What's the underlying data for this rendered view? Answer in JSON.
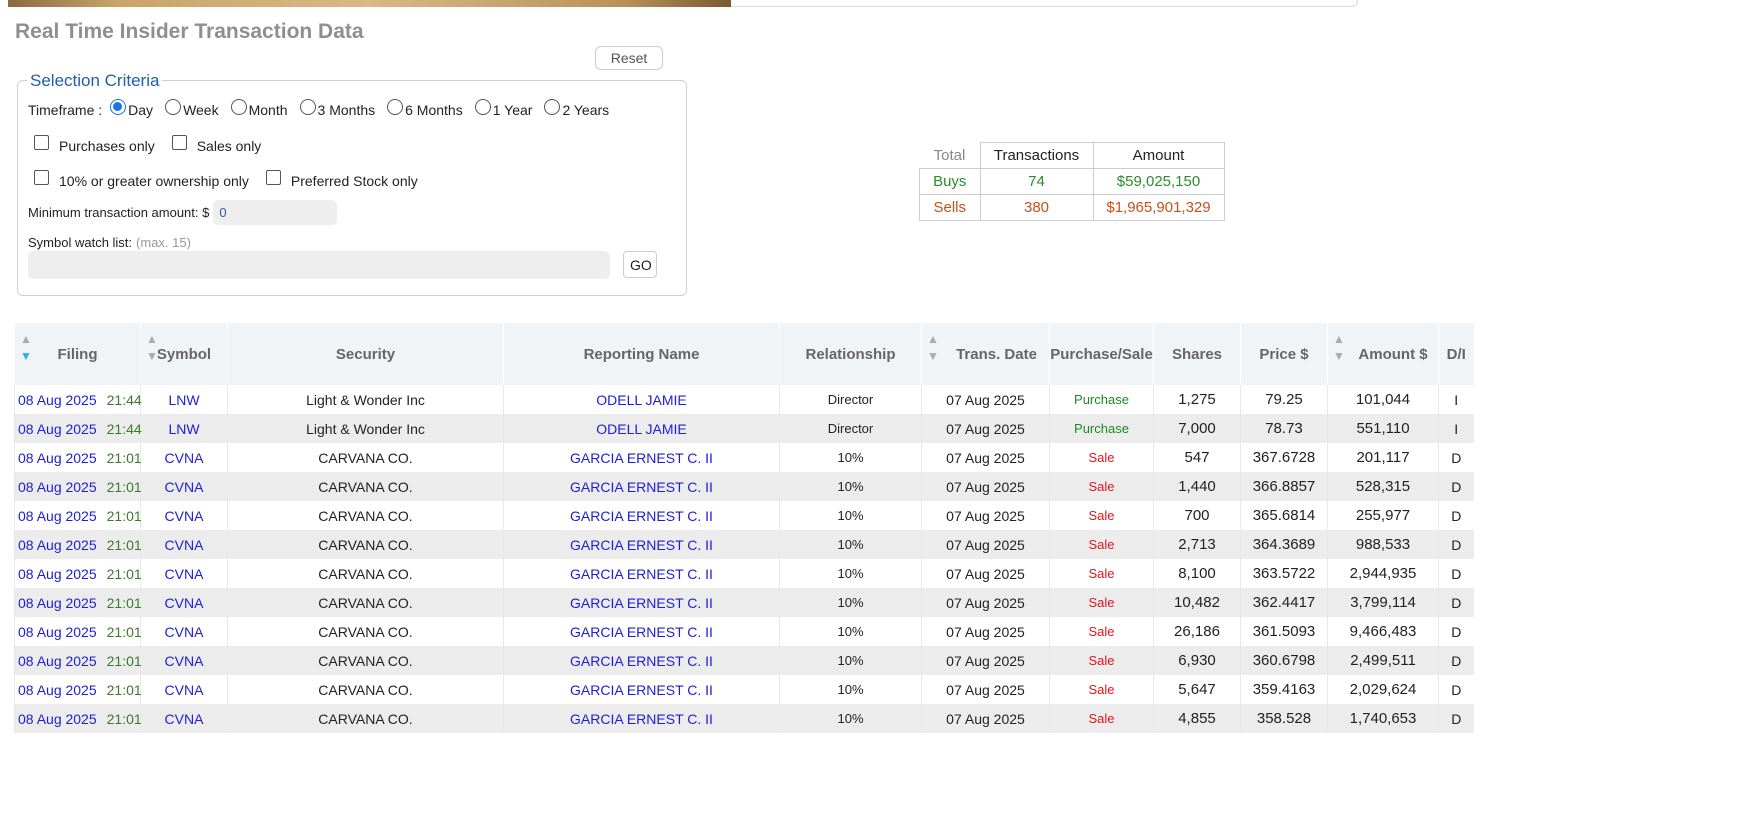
{
  "page_title": "Real Time Insider Transaction Data",
  "reset_label": "Reset",
  "criteria": {
    "legend": "Selection Criteria",
    "timeframe_label": "Timeframe :",
    "timeframes": [
      "Day",
      "Week",
      "Month",
      "3 Months",
      "6 Months",
      "1 Year",
      "2 Years"
    ],
    "selected_timeframe": "Day",
    "purchases_only": "Purchases only",
    "sales_only": "Sales only",
    "ownership_only": "10% or greater ownership only",
    "preferred_only": "Preferred Stock only",
    "min_amount_label": "Minimum transaction amount: $",
    "min_amount_value": "0",
    "watchlist_label": "Symbol watch list:",
    "watchlist_hint": "(max. 15)",
    "go_label": "GO"
  },
  "summary": {
    "corner": "Total",
    "headers": [
      "Transactions",
      "Amount"
    ],
    "buys": {
      "label": "Buys",
      "transactions": "74",
      "amount": "$59,025,150"
    },
    "sells": {
      "label": "Sells",
      "transactions": "380",
      "amount": "$1,965,901,329"
    }
  },
  "table": {
    "headers": [
      "Filing",
      "Symbol",
      "Security",
      "Reporting Name",
      "Relationship",
      "Trans. Date",
      "Purchase/Sale",
      "Shares",
      "Price $",
      "Amount $",
      "D/I"
    ],
    "rows": [
      {
        "date": "08 Aug 2025",
        "time": "21:44",
        "symbol": "LNW",
        "security": "Light & Wonder Inc",
        "name": "ODELL JAMIE",
        "relationship": "Director",
        "trans_date": "07 Aug 2025",
        "type": "Purchase",
        "shares": "1,275",
        "price": "79.25",
        "amount": "101,044",
        "di": "I"
      },
      {
        "date": "08 Aug 2025",
        "time": "21:44",
        "symbol": "LNW",
        "security": "Light & Wonder Inc",
        "name": "ODELL JAMIE",
        "relationship": "Director",
        "trans_date": "07 Aug 2025",
        "type": "Purchase",
        "shares": "7,000",
        "price": "78.73",
        "amount": "551,110",
        "di": "I"
      },
      {
        "date": "08 Aug 2025",
        "time": "21:01",
        "symbol": "CVNA",
        "security": "CARVANA CO.",
        "name": "GARCIA ERNEST C. II",
        "relationship": "10%",
        "trans_date": "07 Aug 2025",
        "type": "Sale",
        "shares": "547",
        "price": "367.6728",
        "amount": "201,117",
        "di": "D"
      },
      {
        "date": "08 Aug 2025",
        "time": "21:01",
        "symbol": "CVNA",
        "security": "CARVANA CO.",
        "name": "GARCIA ERNEST C. II",
        "relationship": "10%",
        "trans_date": "07 Aug 2025",
        "type": "Sale",
        "shares": "1,440",
        "price": "366.8857",
        "amount": "528,315",
        "di": "D"
      },
      {
        "date": "08 Aug 2025",
        "time": "21:01",
        "symbol": "CVNA",
        "security": "CARVANA CO.",
        "name": "GARCIA ERNEST C. II",
        "relationship": "10%",
        "trans_date": "07 Aug 2025",
        "type": "Sale",
        "shares": "700",
        "price": "365.6814",
        "amount": "255,977",
        "di": "D"
      },
      {
        "date": "08 Aug 2025",
        "time": "21:01",
        "symbol": "CVNA",
        "security": "CARVANA CO.",
        "name": "GARCIA ERNEST C. II",
        "relationship": "10%",
        "trans_date": "07 Aug 2025",
        "type": "Sale",
        "shares": "2,713",
        "price": "364.3689",
        "amount": "988,533",
        "di": "D"
      },
      {
        "date": "08 Aug 2025",
        "time": "21:01",
        "symbol": "CVNA",
        "security": "CARVANA CO.",
        "name": "GARCIA ERNEST C. II",
        "relationship": "10%",
        "trans_date": "07 Aug 2025",
        "type": "Sale",
        "shares": "8,100",
        "price": "363.5722",
        "amount": "2,944,935",
        "di": "D"
      },
      {
        "date": "08 Aug 2025",
        "time": "21:01",
        "symbol": "CVNA",
        "security": "CARVANA CO.",
        "name": "GARCIA ERNEST C. II",
        "relationship": "10%",
        "trans_date": "07 Aug 2025",
        "type": "Sale",
        "shares": "10,482",
        "price": "362.4417",
        "amount": "3,799,114",
        "di": "D"
      },
      {
        "date": "08 Aug 2025",
        "time": "21:01",
        "symbol": "CVNA",
        "security": "CARVANA CO.",
        "name": "GARCIA ERNEST C. II",
        "relationship": "10%",
        "trans_date": "07 Aug 2025",
        "type": "Sale",
        "shares": "26,186",
        "price": "361.5093",
        "amount": "9,466,483",
        "di": "D"
      },
      {
        "date": "08 Aug 2025",
        "time": "21:01",
        "symbol": "CVNA",
        "security": "CARVANA CO.",
        "name": "GARCIA ERNEST C. II",
        "relationship": "10%",
        "trans_date": "07 Aug 2025",
        "type": "Sale",
        "shares": "6,930",
        "price": "360.6798",
        "amount": "2,499,511",
        "di": "D"
      },
      {
        "date": "08 Aug 2025",
        "time": "21:01",
        "symbol": "CVNA",
        "security": "CARVANA CO.",
        "name": "GARCIA ERNEST C. II",
        "relationship": "10%",
        "trans_date": "07 Aug 2025",
        "type": "Sale",
        "shares": "5,647",
        "price": "359.4163",
        "amount": "2,029,624",
        "di": "D"
      },
      {
        "date": "08 Aug 2025",
        "time": "21:01",
        "symbol": "CVNA",
        "security": "CARVANA CO.",
        "name": "GARCIA ERNEST C. II",
        "relationship": "10%",
        "trans_date": "07 Aug 2025",
        "type": "Sale",
        "shares": "4,855",
        "price": "358.528",
        "amount": "1,740,653",
        "di": "D"
      }
    ]
  }
}
